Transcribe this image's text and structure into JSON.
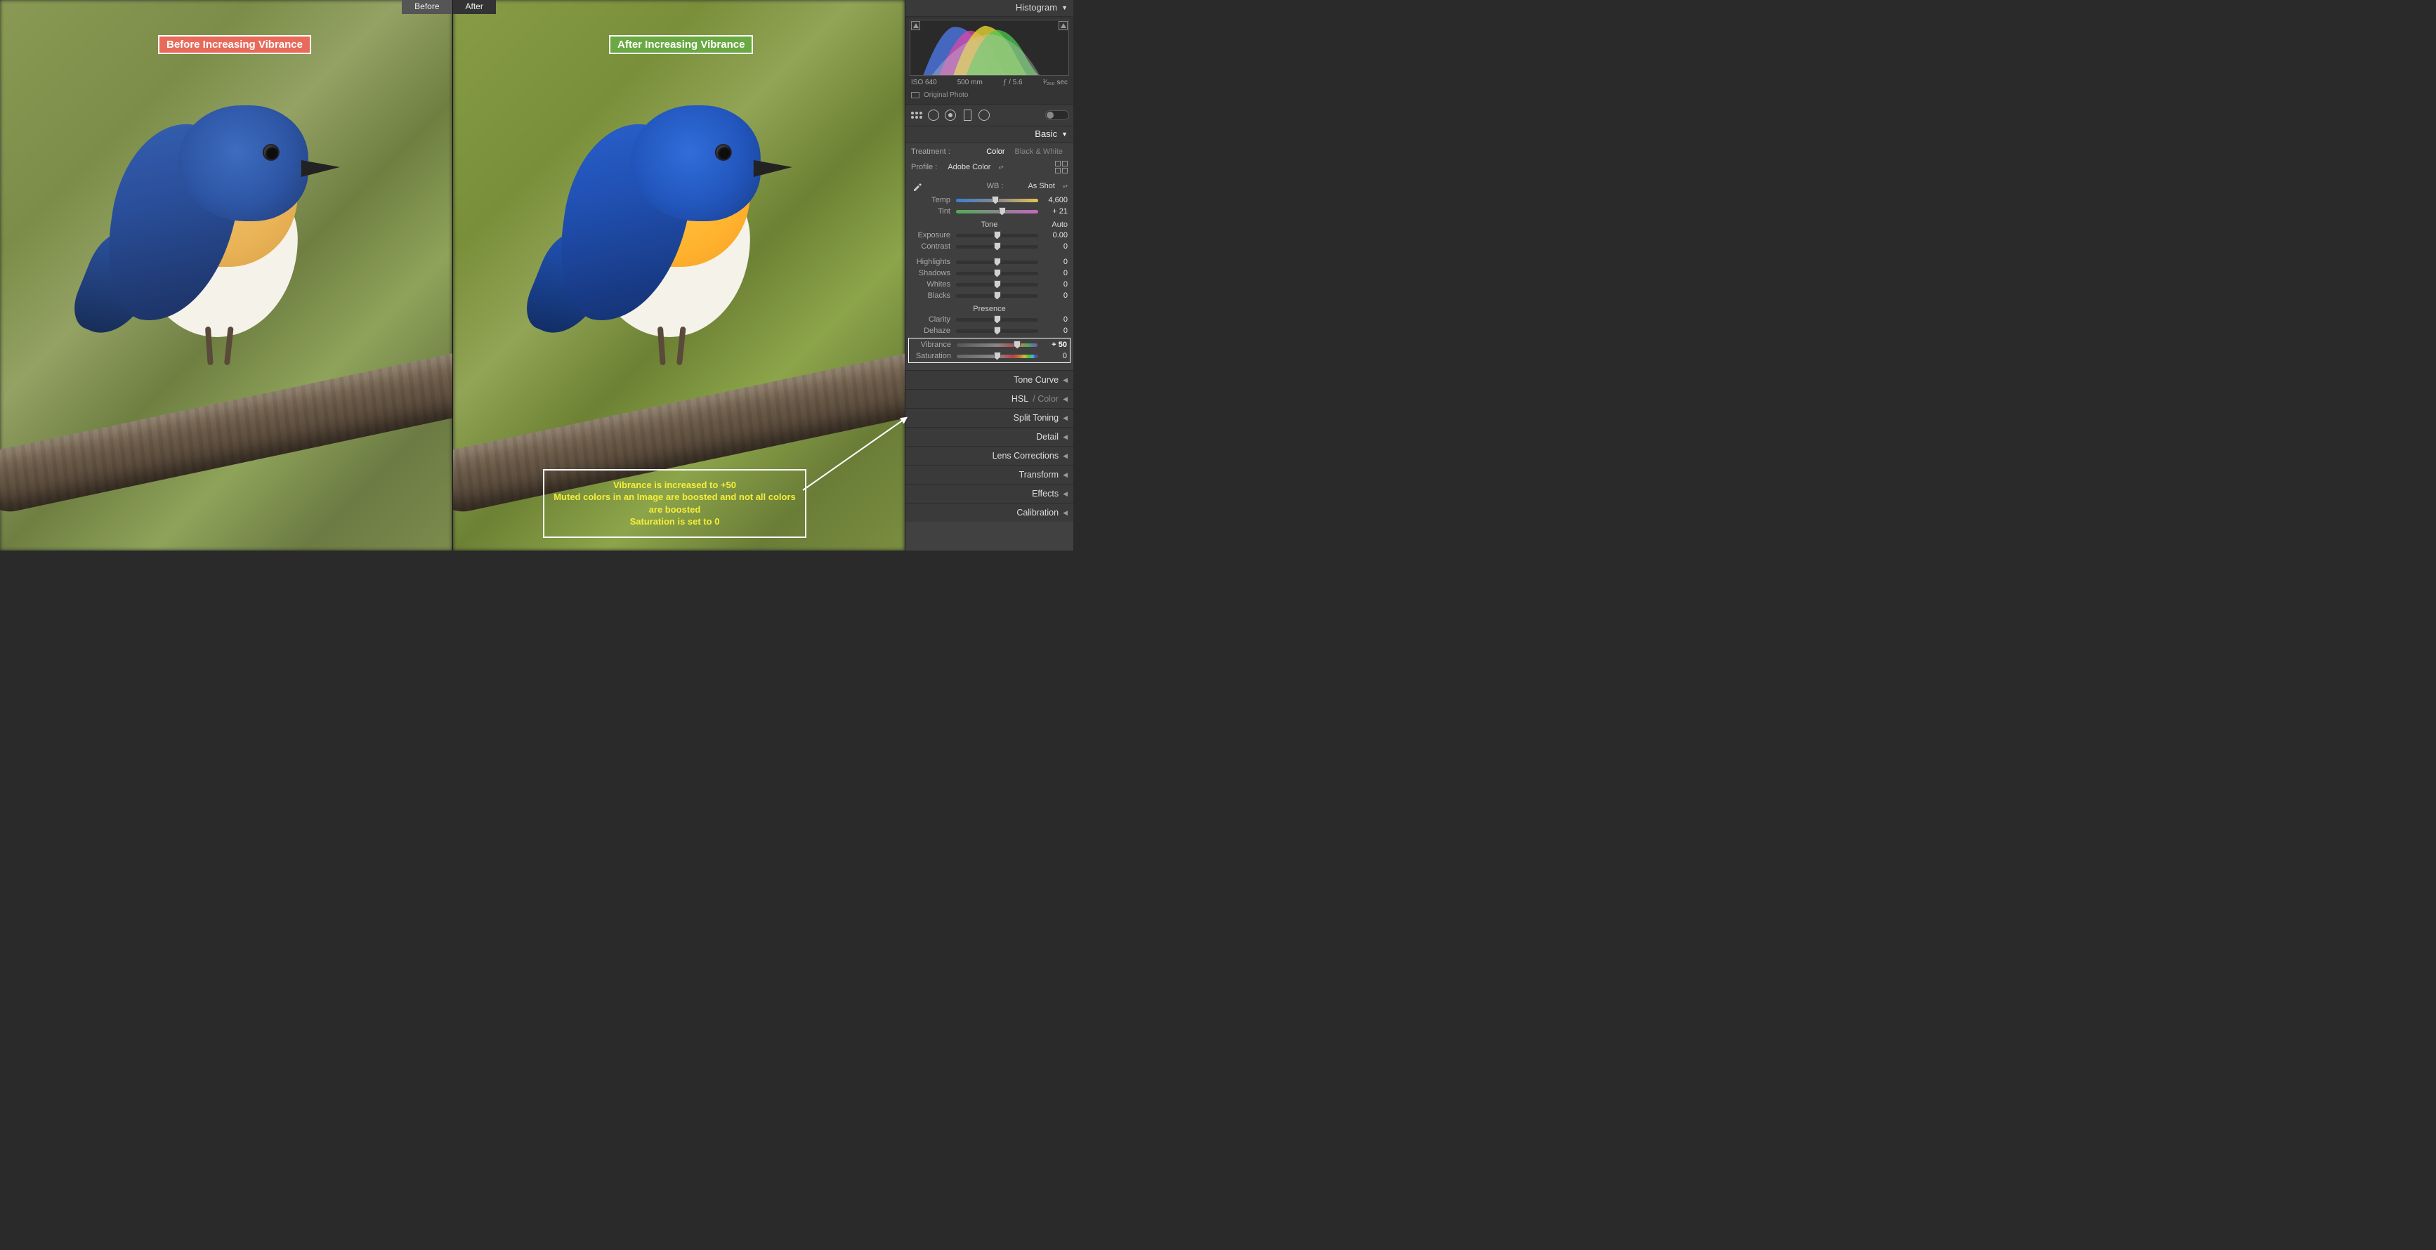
{
  "compare": {
    "before_tab": "Before",
    "after_tab": "After",
    "before_overlay": "Before Increasing Vibrance",
    "after_overlay": "After Increasing Vibrance"
  },
  "callout": {
    "line1": "Vibrance is increased to +50",
    "line2": "Muted colors in an Image are boosted and not all colors are boosted",
    "line3": "Saturation is set to 0"
  },
  "panel": {
    "histogram": {
      "title": "Histogram",
      "meta": {
        "iso": "ISO 640",
        "focal": "500 mm",
        "aperture": "ƒ / 5.6",
        "shutter": "¹⁄₂₅₀ sec"
      },
      "original": "Original Photo"
    },
    "basic": {
      "title": "Basic",
      "treatment_label": "Treatment :",
      "treatment_color": "Color",
      "treatment_bw": "Black & White",
      "profile_label": "Profile :",
      "profile_value": "Adobe Color",
      "wb_label": "WB :",
      "wb_value": "As Shot",
      "temp": {
        "label": "Temp",
        "value": "4,600",
        "pos": 48
      },
      "tint": {
        "label": "Tint",
        "value": "+ 21",
        "pos": 56
      },
      "tone_header": "Tone",
      "auto": "Auto",
      "exposure": {
        "label": "Exposure",
        "value": "0.00",
        "pos": 50
      },
      "contrast": {
        "label": "Contrast",
        "value": "0",
        "pos": 50
      },
      "highlights": {
        "label": "Highlights",
        "value": "0",
        "pos": 50
      },
      "shadows": {
        "label": "Shadows",
        "value": "0",
        "pos": 50
      },
      "whites": {
        "label": "Whites",
        "value": "0",
        "pos": 50
      },
      "blacks": {
        "label": "Blacks",
        "value": "0",
        "pos": 50
      },
      "presence_header": "Presence",
      "clarity": {
        "label": "Clarity",
        "value": "0",
        "pos": 50
      },
      "dehaze": {
        "label": "Dehaze",
        "value": "0",
        "pos": 50
      },
      "vibrance": {
        "label": "Vibrance",
        "value": "+ 50",
        "pos": 75
      },
      "saturation": {
        "label": "Saturation",
        "value": "0",
        "pos": 50
      }
    },
    "collapsed": {
      "tone_curve": "Tone Curve",
      "hsl": "HSL",
      "hsl_color": " / Color",
      "split_toning": "Split Toning",
      "detail": "Detail",
      "lens": "Lens Corrections",
      "transform": "Transform",
      "effects": "Effects",
      "calibration": "Calibration"
    }
  }
}
